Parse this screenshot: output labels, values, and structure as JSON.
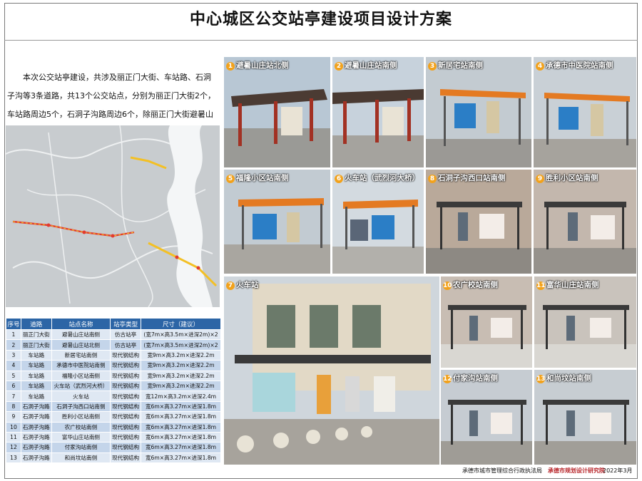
{
  "title": "中心城区公交站亭建设项目设计方案",
  "intro": "本次公交站亭建设，共涉及丽正门大街、车站路、石洞子沟等3条道路，共13个公交站点，分别为丽正门大街2个，车站路周边5个，石洞子沟路周边6个，除丽正门大街避暑山庄站2个站亭为仿古站亭外，其余均为钢结构站亭。",
  "table": {
    "headers": [
      "序号",
      "道路",
      "站点名称",
      "站亭类型",
      "尺寸（建议）"
    ],
    "rows": [
      [
        "1",
        "丽正门大街",
        "避暑山庄站南侧",
        "仿古站亭",
        "(宽7m×高3.5m×进深2m)×2"
      ],
      [
        "2",
        "丽正门大街",
        "避暑山庄站北侧",
        "仿古站亭",
        "(宽7m×高3.5m×进深2m)×2"
      ],
      [
        "3",
        "车站路",
        "新居宅站南侧",
        "现代钢结构",
        "宽9m×高3.2m×进深2.2m"
      ],
      [
        "4",
        "车站路",
        "承德市中医院站南侧",
        "现代钢结构",
        "宽9m×高3.2m×进深2.2m"
      ],
      [
        "5",
        "车站路",
        "福隆小区站南侧",
        "现代钢结构",
        "宽9m×高3.2m×进深2.2m"
      ],
      [
        "6",
        "车站路",
        "火车站（武烈河大桥）",
        "现代钢结构",
        "宽9m×高3.2m×进深2.2m"
      ],
      [
        "7",
        "车站路",
        "火车站",
        "现代钢结构",
        "宽12m×高3.2m×进深2.4m"
      ],
      [
        "8",
        "石洞子沟路",
        "石洞子沟西口站南侧",
        "现代钢结构",
        "宽6m×高3.27m×进深1.8m"
      ],
      [
        "9",
        "石洞子沟路",
        "胜利小区站南侧",
        "现代钢结构",
        "宽6m×高3.27m×进深1.8m"
      ],
      [
        "10",
        "石洞子沟路",
        "农广校站南侧",
        "现代钢结构",
        "宽6m×高3.27m×进深1.8m"
      ],
      [
        "11",
        "石洞子沟路",
        "富华山庄站南侧",
        "现代钢结构",
        "宽6m×高3.27m×进深1.8m"
      ],
      [
        "12",
        "石洞子沟路",
        "付家沟站南侧",
        "现代钢结构",
        "宽6m×高3.27m×进深1.8m"
      ],
      [
        "13",
        "石洞子沟路",
        "和尚坟站南侧",
        "现代钢结构",
        "宽6m×高3.27m×进深1.8m"
      ]
    ]
  },
  "photos": [
    {
      "num": "1",
      "label": "避暑山庄站北侧"
    },
    {
      "num": "2",
      "label": "避暑山庄站南侧"
    },
    {
      "num": "3",
      "label": "新居宅站南侧"
    },
    {
      "num": "4",
      "label": "承德市中医院站南侧"
    },
    {
      "num": "5",
      "label": "福隆小区站南侧"
    },
    {
      "num": "6",
      "label": "火车站（武烈河大桥）"
    },
    {
      "num": "8",
      "label": "石洞子沟西口站南侧"
    },
    {
      "num": "9",
      "label": "胜利小区站南侧"
    },
    {
      "num": "7",
      "label": "火车站"
    },
    {
      "num": "10",
      "label": "农广校站南侧"
    },
    {
      "num": "11",
      "label": "富华山庄站南侧"
    },
    {
      "num": "12",
      "label": "付家沟站南侧"
    },
    {
      "num": "13",
      "label": "和尚坟站南侧"
    }
  ],
  "footer": {
    "left": "承德市城市管理综合行政执法局",
    "right": "承德市规划设计研究院",
    "date": "2022年3月"
  },
  "colors": {
    "table_header": "#2c65a6",
    "row_a": "#dfe8f3",
    "row_b": "#c4d5ea",
    "badge": "#f2a21c"
  }
}
